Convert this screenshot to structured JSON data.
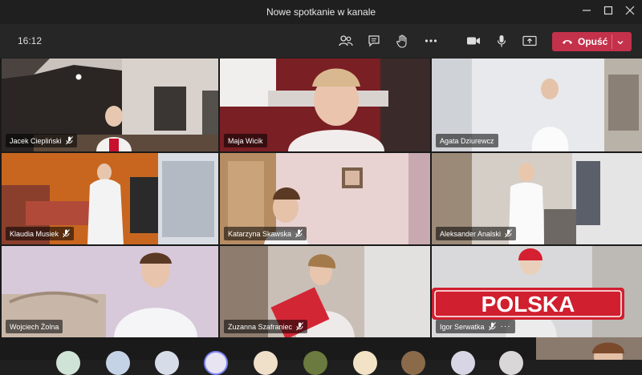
{
  "window": {
    "title": "Nowe spotkanie w kanale",
    "controls": [
      "minimize-icon",
      "maximize-icon",
      "close-icon"
    ]
  },
  "toolbar": {
    "time": "16:12",
    "icons": [
      "participants-icon",
      "chat-icon",
      "raise-hand-icon",
      "more-actions-icon",
      "camera-icon",
      "microphone-icon",
      "share-screen-icon"
    ],
    "leave_label": "Opuść",
    "leave_color": "#c4314b"
  },
  "participants": [
    {
      "name": "Jacek Ciepliński",
      "muted": true
    },
    {
      "name": "Maja Wicik",
      "muted": false
    },
    {
      "name": "Agata Dziurewcz",
      "muted": false
    },
    {
      "name": "Klaudia Musiek",
      "muted": true
    },
    {
      "name": "Katarzyna Skawska",
      "muted": true
    },
    {
      "name": "Aleksander Analski",
      "muted": true
    },
    {
      "name": "Wojciech Żolna",
      "muted": false
    },
    {
      "name": "Zuzanna Szafraniec",
      "muted": true
    },
    {
      "name": "Igor Serwatka",
      "muted": true,
      "more": "···"
    }
  ],
  "banner_text": "POLSKA"
}
